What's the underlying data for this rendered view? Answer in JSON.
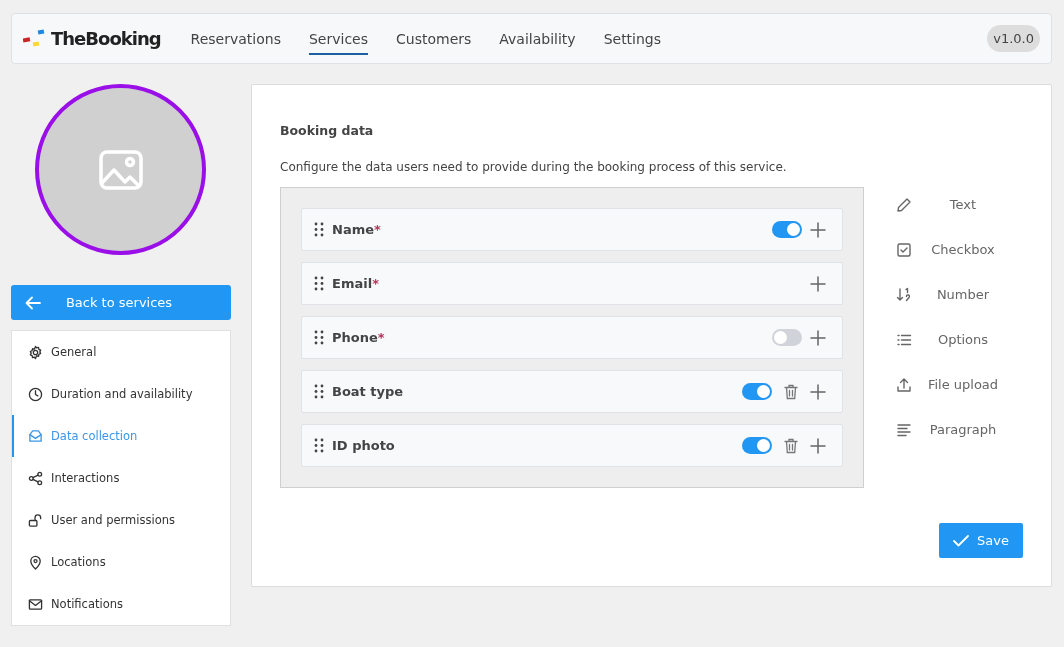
{
  "header": {
    "logo": "TheBooking",
    "nav": [
      {
        "label": "Reservations",
        "selected": false
      },
      {
        "label": "Services",
        "selected": true
      },
      {
        "label": "Customers",
        "selected": false
      },
      {
        "label": "Availability",
        "selected": false
      },
      {
        "label": "Settings",
        "selected": false
      }
    ],
    "version": "v1.0.0"
  },
  "sidebar": {
    "back_button": "Back to services",
    "items": [
      {
        "label": "General",
        "selected": false
      },
      {
        "label": "Duration and availability",
        "selected": false
      },
      {
        "label": "Data collection",
        "selected": true
      },
      {
        "label": "Interactions",
        "selected": false
      },
      {
        "label": "User and permissions",
        "selected": false
      },
      {
        "label": "Locations",
        "selected": false
      },
      {
        "label": "Notifications",
        "selected": false
      }
    ]
  },
  "content": {
    "title": "Booking data",
    "description": "Configure the data users need to provide during the booking process of this service.",
    "fields": [
      {
        "label": "Name",
        "required_mark": "*",
        "kind": "switch",
        "on": true,
        "deletable": false
      },
      {
        "label": "Email",
        "required_mark": "*",
        "kind": "plain",
        "deletable": false
      },
      {
        "label": "Phone",
        "required_mark": "*",
        "kind": "switch",
        "on": false,
        "deletable": false
      },
      {
        "label": "Boat type",
        "kind": "switch",
        "on": true,
        "deletable": true
      },
      {
        "label": "ID photo",
        "kind": "switch",
        "on": true,
        "deletable": true
      }
    ],
    "field_types": [
      {
        "label": "Text"
      },
      {
        "label": "Checkbox"
      },
      {
        "label": "Number"
      },
      {
        "label": "Options"
      },
      {
        "label": "File upload"
      },
      {
        "label": "Paragraph"
      }
    ],
    "save_button": "Save"
  }
}
